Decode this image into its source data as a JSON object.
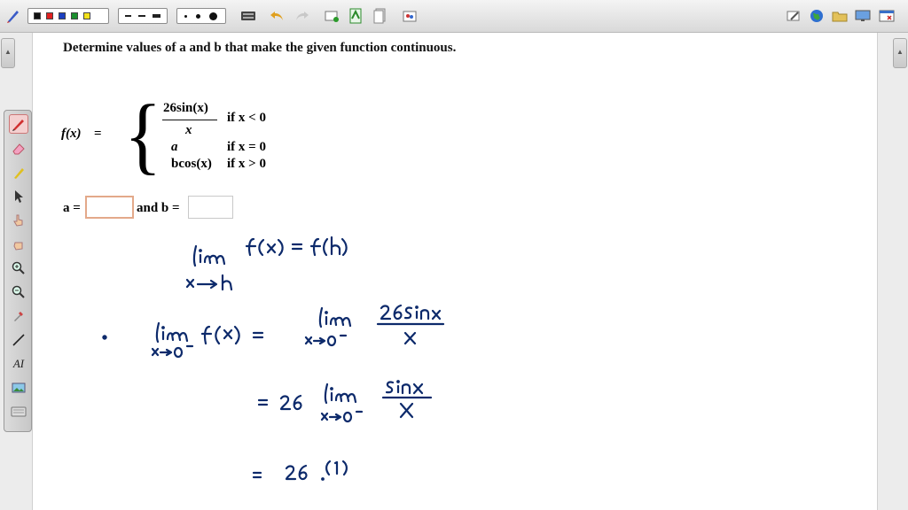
{
  "toolbar": {
    "color_swatches": [
      "#111111",
      "#e02020",
      "#1a3fbf",
      "#1b8f2e",
      "#f2e11a"
    ],
    "line_styles": [
      "dash-long",
      "dash-medium",
      "dash-solid"
    ],
    "dot_sizes": [
      "small",
      "medium",
      "large"
    ],
    "icons": [
      "pen-logo-icon",
      "keyboard-icon",
      "undo-icon",
      "redo-icon",
      "new-page-icon",
      "document-icon",
      "pages-icon",
      "paint-icon",
      "edit-icon",
      "globe-icon",
      "folder-icon",
      "monitor-icon",
      "close-window-icon"
    ]
  },
  "palette": {
    "tools": [
      "pen-icon",
      "eraser-icon",
      "highlighter-icon",
      "pointer-icon",
      "hand-point-icon",
      "hand-grab-icon",
      "zoom-in-icon",
      "zoom-out-icon",
      "eyedropper-icon",
      "line-icon",
      "text-icon",
      "image-icon",
      "keyboard-icon"
    ],
    "text_tool_label": "AI"
  },
  "question": {
    "title": "Determine values of a and b that make the given function continuous.",
    "function_name": "f(x)",
    "equals": "=",
    "case1_numerator": "26sin(x)",
    "case1_denominator": "x",
    "case1_condition": "if x < 0",
    "case2_value": "a",
    "case2_condition": "if x = 0",
    "case3_value": "bcos(x)",
    "case3_condition": "if x > 0",
    "answer_a_label": "a =",
    "answer_b_label": "and b =",
    "answer_a_value": "",
    "answer_b_value": ""
  },
  "handwriting": {
    "ink_color": "#0d2a6b",
    "lines": [
      "lim f(x) = f(h)",
      "x→h",
      "lim f(x) = lim 26sinx/x",
      "x→0⁻ x→0⁻",
      "= 26 lim sinx/x",
      "x→0⁻",
      "= 26 (1)"
    ]
  }
}
